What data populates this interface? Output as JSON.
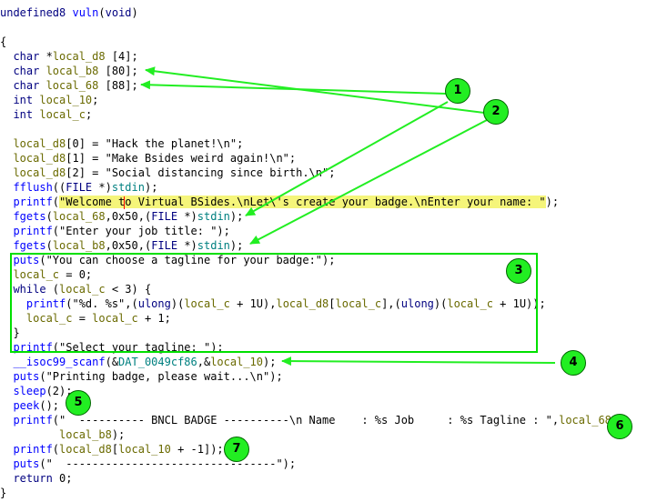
{
  "lines": [
    {
      "segments": [
        {
          "t": "undefined8 ",
          "c": "kw"
        },
        {
          "t": "vuln",
          "c": "fn"
        },
        {
          "t": "(",
          "c": ""
        },
        {
          "t": "void",
          "c": "kw"
        },
        {
          "t": ")",
          "c": ""
        }
      ]
    },
    {
      "segments": []
    },
    {
      "segments": [
        {
          "t": "{",
          "c": ""
        }
      ]
    },
    {
      "segments": [
        {
          "t": "  char ",
          "c": "kw"
        },
        {
          "t": "*",
          "c": ""
        },
        {
          "t": "local_d8",
          "c": "var"
        },
        {
          "t": " [4];",
          "c": ""
        }
      ]
    },
    {
      "segments": [
        {
          "t": "  char ",
          "c": "kw"
        },
        {
          "t": "local_b8",
          "c": "var"
        },
        {
          "t": " [80];",
          "c": ""
        }
      ]
    },
    {
      "segments": [
        {
          "t": "  char ",
          "c": "kw"
        },
        {
          "t": "local_68",
          "c": "var"
        },
        {
          "t": " [88];",
          "c": ""
        }
      ]
    },
    {
      "segments": [
        {
          "t": "  int ",
          "c": "kw"
        },
        {
          "t": "local_10",
          "c": "var"
        },
        {
          "t": ";",
          "c": ""
        }
      ]
    },
    {
      "segments": [
        {
          "t": "  int ",
          "c": "kw"
        },
        {
          "t": "local_c",
          "c": "var"
        },
        {
          "t": ";",
          "c": ""
        }
      ]
    },
    {
      "segments": []
    },
    {
      "segments": [
        {
          "t": "  local_d8",
          "c": "var"
        },
        {
          "t": "[0] = \"Hack the planet!\\n\";",
          "c": ""
        }
      ]
    },
    {
      "segments": [
        {
          "t": "  local_d8",
          "c": "var"
        },
        {
          "t": "[1] = \"Make Bsides weird again!\\n\";",
          "c": ""
        }
      ]
    },
    {
      "segments": [
        {
          "t": "  local_d8",
          "c": "var"
        },
        {
          "t": "[2] = \"Social distancing since birth.\\n\";",
          "c": ""
        }
      ]
    },
    {
      "segments": [
        {
          "t": "  fflush",
          "c": "fn"
        },
        {
          "t": "((",
          "c": ""
        },
        {
          "t": "FILE",
          "c": "kw"
        },
        {
          "t": " *)",
          "c": ""
        },
        {
          "t": "stdin",
          "c": "dat"
        },
        {
          "t": ");",
          "c": ""
        }
      ]
    },
    {
      "segments": [
        {
          "t": "  printf",
          "c": "fn"
        },
        {
          "t": "(",
          "c": ""
        },
        {
          "t": "\"Welcome t",
          "c": "hl"
        },
        {
          "t": "CURSOR",
          "c": "cur"
        },
        {
          "t": "o Virtual BSides.\\nLet\\'s create your badge.\\nEnter your name: \"",
          "c": "hl"
        },
        {
          "t": ");",
          "c": ""
        }
      ]
    },
    {
      "segments": [
        {
          "t": "  fgets",
          "c": "fn"
        },
        {
          "t": "(",
          "c": ""
        },
        {
          "t": "local_68",
          "c": "var"
        },
        {
          "t": ",0x50,(",
          "c": ""
        },
        {
          "t": "FILE",
          "c": "kw"
        },
        {
          "t": " *)",
          "c": ""
        },
        {
          "t": "stdin",
          "c": "dat"
        },
        {
          "t": ");",
          "c": ""
        }
      ]
    },
    {
      "segments": [
        {
          "t": "  printf",
          "c": "fn"
        },
        {
          "t": "(\"Enter your job title: \");",
          "c": ""
        }
      ]
    },
    {
      "segments": [
        {
          "t": "  fgets",
          "c": "fn"
        },
        {
          "t": "(",
          "c": ""
        },
        {
          "t": "local_b8",
          "c": "var"
        },
        {
          "t": ",0x50,(",
          "c": ""
        },
        {
          "t": "FILE",
          "c": "kw"
        },
        {
          "t": " *)",
          "c": ""
        },
        {
          "t": "stdin",
          "c": "dat"
        },
        {
          "t": ");",
          "c": ""
        }
      ]
    },
    {
      "segments": [
        {
          "t": "  puts",
          "c": "fn"
        },
        {
          "t": "(\"You can choose a tagline for your badge:\");",
          "c": ""
        }
      ]
    },
    {
      "segments": [
        {
          "t": "  local_c",
          "c": "var"
        },
        {
          "t": " = 0;",
          "c": ""
        }
      ]
    },
    {
      "segments": [
        {
          "t": "  while",
          "c": "kw"
        },
        {
          "t": " (",
          "c": ""
        },
        {
          "t": "local_c",
          "c": "var"
        },
        {
          "t": " < 3) {",
          "c": ""
        }
      ]
    },
    {
      "segments": [
        {
          "t": "    printf",
          "c": "fn"
        },
        {
          "t": "(\"%d. %s\",(",
          "c": ""
        },
        {
          "t": "ulong",
          "c": "kw"
        },
        {
          "t": ")(",
          "c": ""
        },
        {
          "t": "local_c",
          "c": "var"
        },
        {
          "t": " + 1U),",
          "c": ""
        },
        {
          "t": "local_d8",
          "c": "var"
        },
        {
          "t": "[",
          "c": ""
        },
        {
          "t": "local_c",
          "c": "var"
        },
        {
          "t": "],(",
          "c": ""
        },
        {
          "t": "ulong",
          "c": "kw"
        },
        {
          "t": ")(",
          "c": ""
        },
        {
          "t": "local_c",
          "c": "var"
        },
        {
          "t": " + 1U));",
          "c": ""
        }
      ]
    },
    {
      "segments": [
        {
          "t": "    local_c",
          "c": "var"
        },
        {
          "t": " = ",
          "c": ""
        },
        {
          "t": "local_c",
          "c": "var"
        },
        {
          "t": " + 1;",
          "c": ""
        }
      ]
    },
    {
      "segments": [
        {
          "t": "  }",
          "c": ""
        }
      ]
    },
    {
      "segments": [
        {
          "t": "  printf",
          "c": "fn"
        },
        {
          "t": "(\"Select your tagline: \");",
          "c": ""
        }
      ]
    },
    {
      "segments": [
        {
          "t": "  __isoc99_scanf",
          "c": "fn"
        },
        {
          "t": "(&",
          "c": ""
        },
        {
          "t": "DAT_0049cf86",
          "c": "dat"
        },
        {
          "t": ",&",
          "c": ""
        },
        {
          "t": "local_10",
          "c": "var"
        },
        {
          "t": ");",
          "c": ""
        }
      ]
    },
    {
      "segments": [
        {
          "t": "  puts",
          "c": "fn"
        },
        {
          "t": "(\"Printing badge, please wait...\\n\");",
          "c": ""
        }
      ]
    },
    {
      "segments": [
        {
          "t": "  sleep",
          "c": "fn"
        },
        {
          "t": "(2);",
          "c": ""
        }
      ]
    },
    {
      "segments": [
        {
          "t": "  peek",
          "c": "fn"
        },
        {
          "t": "();",
          "c": ""
        }
      ]
    },
    {
      "segments": [
        {
          "t": "  printf",
          "c": "fn"
        },
        {
          "t": "(\"  ---------- BNCL BADGE ----------\\n Name    : %s Job     : %s Tagline : \",",
          "c": ""
        },
        {
          "t": "local_68",
          "c": "var"
        },
        {
          "t": ",",
          "c": ""
        }
      ]
    },
    {
      "segments": [
        {
          "t": "         local_b8",
          "c": "var"
        },
        {
          "t": ");",
          "c": ""
        }
      ]
    },
    {
      "segments": [
        {
          "t": "  printf",
          "c": "fn"
        },
        {
          "t": "(",
          "c": ""
        },
        {
          "t": "local_d8",
          "c": "var"
        },
        {
          "t": "[",
          "c": ""
        },
        {
          "t": "local_10",
          "c": "var"
        },
        {
          "t": " + -1]);",
          "c": ""
        }
      ]
    },
    {
      "segments": [
        {
          "t": "  puts",
          "c": "fn"
        },
        {
          "t": "(\"  --------------------------------\");",
          "c": ""
        }
      ]
    },
    {
      "segments": [
        {
          "t": "  return",
          "c": "kw"
        },
        {
          "t": " 0;",
          "c": ""
        }
      ]
    },
    {
      "segments": [
        {
          "t": "}",
          "c": ""
        }
      ]
    }
  ],
  "annotations": [
    {
      "label": "1"
    },
    {
      "label": "2"
    },
    {
      "label": "3"
    },
    {
      "label": "4"
    },
    {
      "label": "5"
    },
    {
      "label": "6"
    },
    {
      "label": "7"
    }
  ],
  "colors": {
    "keyword": "#000080",
    "function": "#0000ff",
    "variable": "#6a6a00",
    "global": "#008080",
    "highlight": "#f5f57a",
    "annotation": "#22ee22"
  }
}
